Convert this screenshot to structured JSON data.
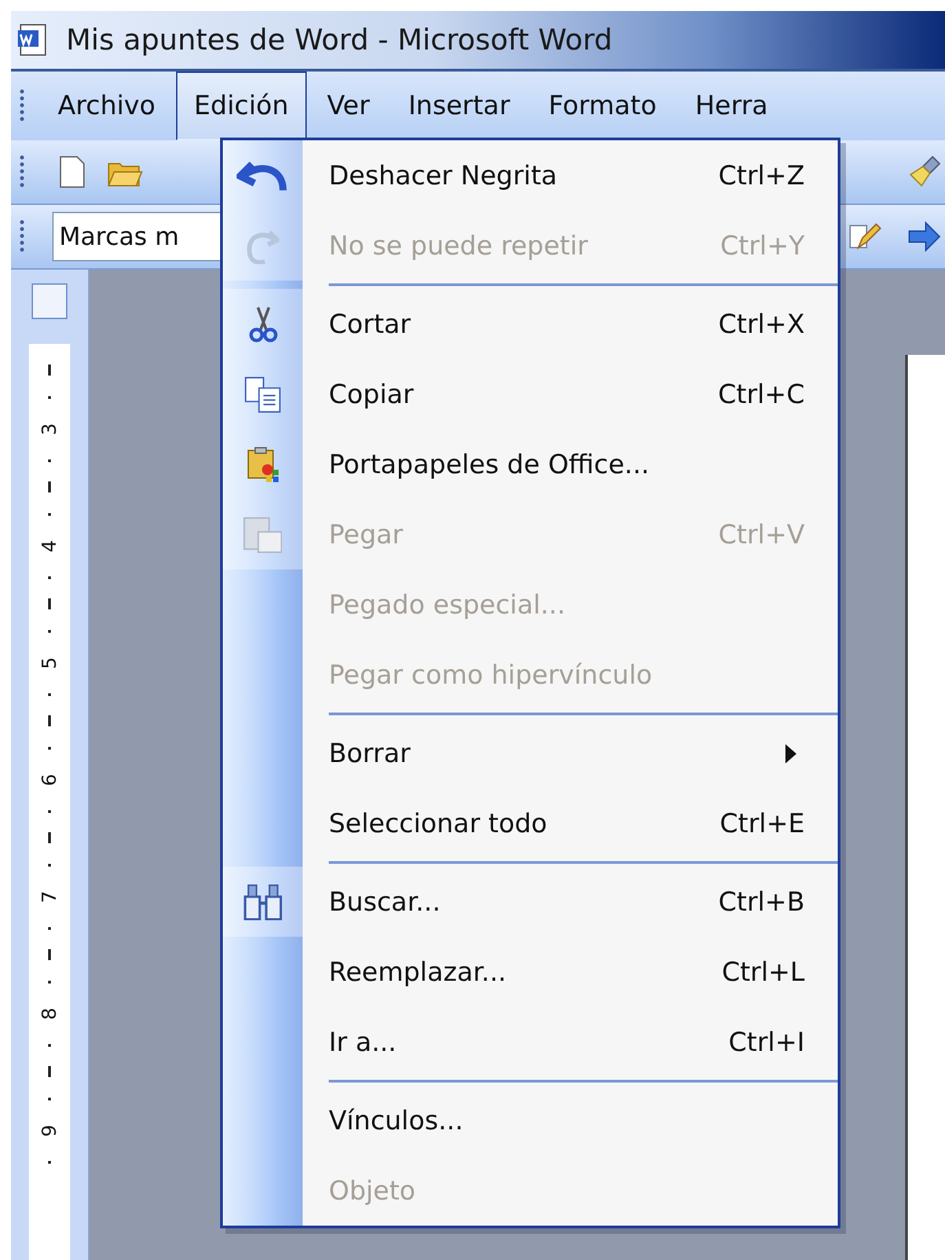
{
  "window": {
    "title": "Mis apuntes de Word - Microsoft Word"
  },
  "menu_bar": [
    {
      "label": "Archivo",
      "selected": false
    },
    {
      "label": "Edición",
      "selected": true
    },
    {
      "label": "Ver",
      "selected": false
    },
    {
      "label": "Insertar",
      "selected": false
    },
    {
      "label": "Formato",
      "selected": false
    },
    {
      "label": "Herra",
      "selected": false
    }
  ],
  "style_box": {
    "value": "Marcas m"
  },
  "vertical_ruler": {
    "labels": [
      "3",
      "4",
      "5",
      "6",
      "7",
      "8",
      "9"
    ]
  },
  "edit_menu": [
    {
      "kind": "item",
      "label": "Deshacer Negrita",
      "shortcut": "Ctrl+Z",
      "disabled": false
    },
    {
      "kind": "item",
      "label": "No se puede repetir",
      "shortcut": "Ctrl+Y",
      "disabled": true
    },
    {
      "kind": "separator"
    },
    {
      "kind": "item",
      "label": "Cortar",
      "shortcut": "Ctrl+X",
      "disabled": false
    },
    {
      "kind": "item",
      "label": "Copiar",
      "shortcut": "Ctrl+C",
      "disabled": false
    },
    {
      "kind": "item",
      "label": "Portapapeles de Office...",
      "disabled": false
    },
    {
      "kind": "item",
      "label": "Pegar",
      "shortcut": "Ctrl+V",
      "disabled": true
    },
    {
      "kind": "item",
      "label": "Pegado especial...",
      "disabled": true
    },
    {
      "kind": "item",
      "label": "Pegar como hipervínculo",
      "disabled": true
    },
    {
      "kind": "separator"
    },
    {
      "kind": "item",
      "label": "Borrar",
      "disabled": false,
      "submenu": true
    },
    {
      "kind": "item",
      "label": "Seleccionar todo",
      "shortcut": "Ctrl+E",
      "disabled": false
    },
    {
      "kind": "separator"
    },
    {
      "kind": "item",
      "label": "Buscar...",
      "shortcut": "Ctrl+B",
      "disabled": false
    },
    {
      "kind": "item",
      "label": "Reemplazar...",
      "shortcut": "Ctrl+L",
      "disabled": false
    },
    {
      "kind": "item",
      "label": "Ir a...",
      "shortcut": "Ctrl+I",
      "disabled": false
    },
    {
      "kind": "separator"
    },
    {
      "kind": "item",
      "label": "Vínculos...",
      "disabled": false
    },
    {
      "kind": "item",
      "label": "Objeto",
      "disabled": true
    }
  ]
}
